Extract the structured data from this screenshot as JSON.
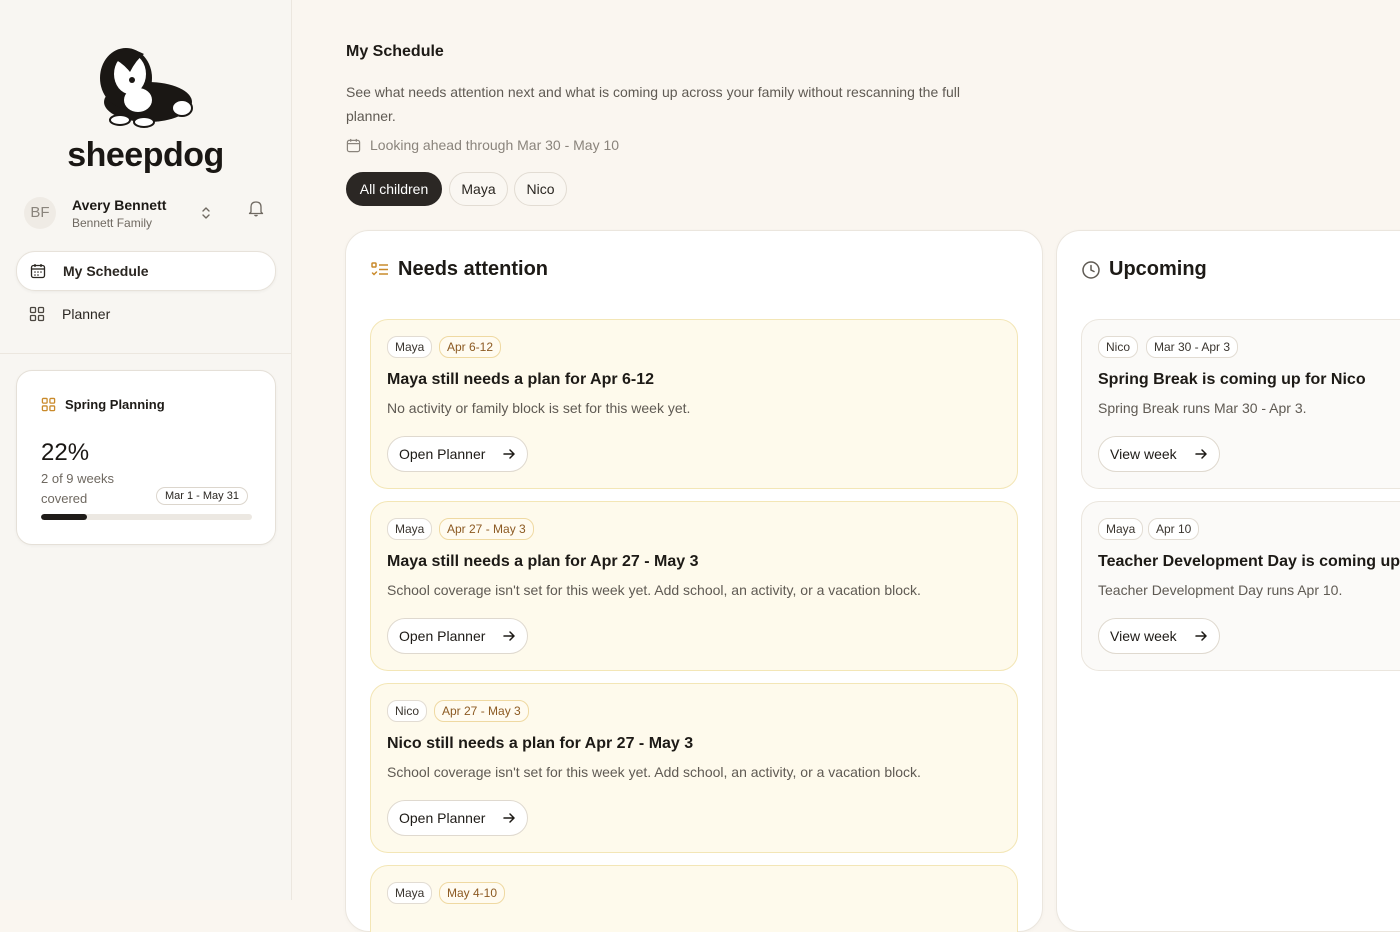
{
  "sidebar": {
    "brand": "sheepdog",
    "account": {
      "initials": "BF",
      "name": "Avery Bennett",
      "family": "Bennett Family"
    },
    "nav": [
      {
        "label": "My Schedule",
        "icon": "calendar-icon",
        "active": true
      },
      {
        "label": "Planner",
        "icon": "grid-icon",
        "active": false
      }
    ],
    "planning": {
      "title": "Spring Planning",
      "percent": "22%",
      "progress": 0.22,
      "sub": "2 of 9 weeks covered",
      "range": "Mar 1 - May 31"
    }
  },
  "main": {
    "title": "My Schedule",
    "description": "See what needs attention next and what is coming up across your family without rescanning the full planner.",
    "ahead": "Looking ahead through Mar 30 - May 10",
    "filters": [
      {
        "label": "All children",
        "active": true
      },
      {
        "label": "Maya",
        "active": false
      },
      {
        "label": "Nico",
        "active": false
      }
    ],
    "needs_attention": {
      "title": "Needs attention",
      "items": [
        {
          "child": "Maya",
          "date": "Apr 6-12",
          "title": "Maya still needs a plan for Apr 6-12",
          "desc": "No activity or family block is set for this week yet.",
          "button": "Open Planner"
        },
        {
          "child": "Maya",
          "date": "Apr 27 - May 3",
          "title": "Maya still needs a plan for Apr 27 - May 3",
          "desc": "School coverage isn't set for this week yet. Add school, an activity, or a vacation block.",
          "button": "Open Planner"
        },
        {
          "child": "Nico",
          "date": "Apr 27 - May 3",
          "title": "Nico still needs a plan for Apr 27 - May 3",
          "desc": "School coverage isn't set for this week yet. Add school, an activity, or a vacation block.",
          "button": "Open Planner"
        },
        {
          "child": "Maya",
          "date": "May 4-10"
        }
      ]
    },
    "upcoming": {
      "title": "Upcoming",
      "items": [
        {
          "child": "Nico",
          "date": "Mar 30 - Apr 3",
          "title": "Spring Break is coming up for Nico",
          "desc": "Spring Break runs Mar 30 - Apr 3.",
          "button": "View week"
        },
        {
          "child": "Maya",
          "date": "Apr 10",
          "title": "Teacher Development Day is coming up",
          "desc": "Teacher Development Day runs Apr 10.",
          "button": "View week"
        }
      ]
    }
  }
}
